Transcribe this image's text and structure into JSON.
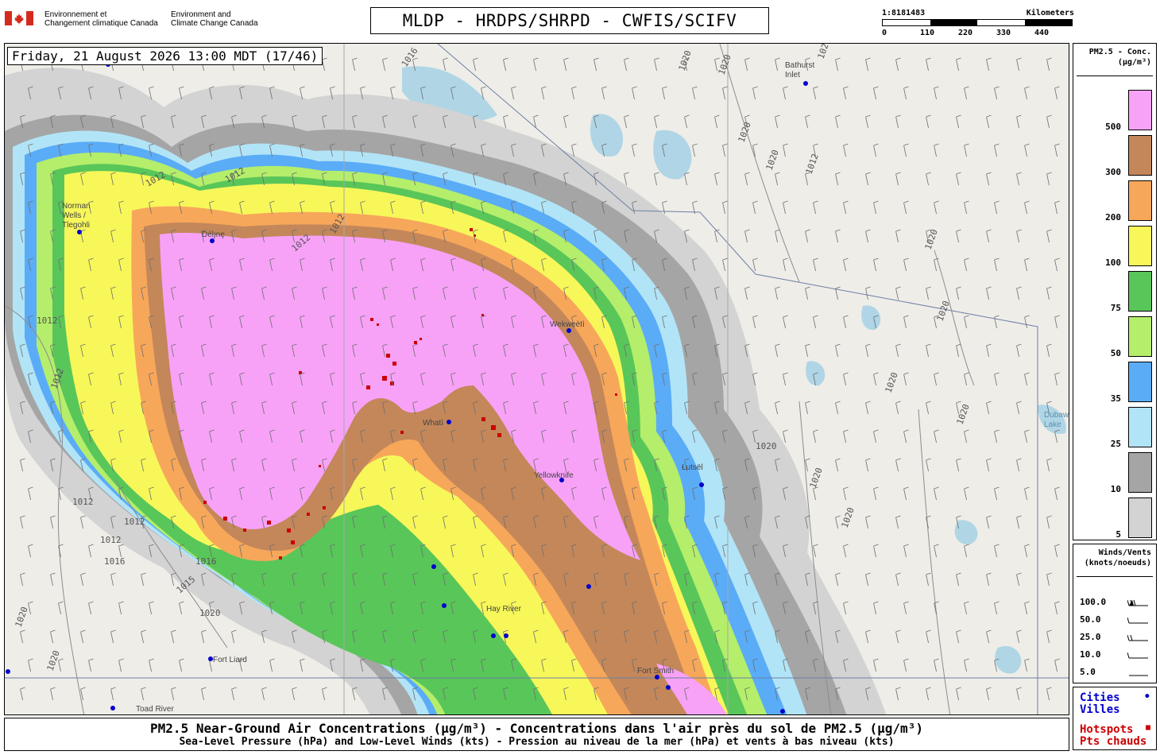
{
  "header": {
    "agency_fr": [
      "Environnement et",
      "Changement climatique Canada"
    ],
    "agency_en": [
      "Environment and",
      "Climate Change Canada"
    ],
    "title": "MLDP - HRDPS/SHRPD - CWFIS/SCIFV",
    "scale_ratio": "1:8181483",
    "scale_unit": "Kilometers",
    "scale_ticks": [
      "0",
      "110",
      "220",
      "330",
      "440"
    ]
  },
  "map": {
    "datetime": "Friday, 21 August 2026 13:00 MDT (17/46)",
    "places": [
      {
        "name": "Bathurst Inlet",
        "lines": [
          "Bathurst",
          "Inlet"
        ]
      },
      {
        "name": "Norman Wells / Tlegohli",
        "lines": [
          "Norman",
          "Wells /",
          "Tlegohli"
        ]
      },
      {
        "name": "Délı̨nę",
        "lines": [
          "Délı̨nę"
        ]
      },
      {
        "name": "Wekweètì",
        "lines": [
          "Wekweètì"
        ]
      },
      {
        "name": "Whatì",
        "lines": [
          "Whatì"
        ]
      },
      {
        "name": "Yellowknife",
        "lines": [
          "Yellowknife"
        ]
      },
      {
        "name": "Łutsël",
        "lines": [
          "Łutsël"
        ]
      },
      {
        "name": "Hay River",
        "lines": [
          "Hay River"
        ]
      },
      {
        "name": "Fort Smith",
        "lines": [
          "Fort Smith"
        ]
      },
      {
        "name": "Fort Liard",
        "lines": [
          "Fort Liard"
        ]
      },
      {
        "name": "Toad River",
        "lines": [
          "Toad River"
        ]
      },
      {
        "name": "Dubawnt Lake",
        "lines": [
          "Dubawnt",
          "Lake"
        ]
      }
    ],
    "isobar_labels": [
      "1016",
      "1020",
      "1020",
      "1020",
      "1020",
      "1020",
      "1012",
      "1012",
      "1012",
      "1012",
      "1012",
      "1012",
      "1012",
      "1012",
      "1012",
      "1012",
      "1016",
      "1016",
      "1015",
      "1020",
      "1020",
      "1020",
      "1020",
      "1020",
      "1020",
      "1020",
      "1020",
      "1020",
      "1020"
    ]
  },
  "legend": {
    "title_lines": [
      "PM2.5 - Conc.",
      "(µg/m³)"
    ],
    "levels": [
      {
        "label": "500",
        "color": "#f7a2f7"
      },
      {
        "label": "300",
        "color": "#c3875a"
      },
      {
        "label": "200",
        "color": "#f7a75a"
      },
      {
        "label": "100",
        "color": "#f7f75a"
      },
      {
        "label": "75",
        "color": "#59c659"
      },
      {
        "label": "50",
        "color": "#b4ee6b"
      },
      {
        "label": "35",
        "color": "#5aacf7"
      },
      {
        "label": "25",
        "color": "#b2e4f7"
      },
      {
        "label": "10",
        "color": "#a5a5a5"
      },
      {
        "label": "5",
        "color": "#d3d3d3"
      }
    ]
  },
  "winds": {
    "title_lines": [
      "Winds/Vents",
      "(knots/noeuds)"
    ],
    "entries": [
      "100.0",
      "50.0",
      "25.0",
      "10.0",
      "5.0"
    ]
  },
  "keys": {
    "cities": [
      "Cities",
      "Villes"
    ],
    "hotspots": [
      "Hotspots",
      "Pts chauds"
    ],
    "city_color": "#0000cc",
    "hotspot_color": "#cc0000"
  },
  "footer": {
    "title": "PM2.5 Near-Ground Air Concentrations (µg/m³) - Concentrations dans l'air près du sol de PM2.5 (µg/m³)",
    "subtitle": "Sea-Level Pressure (hPa) and Low-Level Winds (kts) - Pression au niveau de la mer (hPa) et vents à bas niveau (kts)"
  }
}
